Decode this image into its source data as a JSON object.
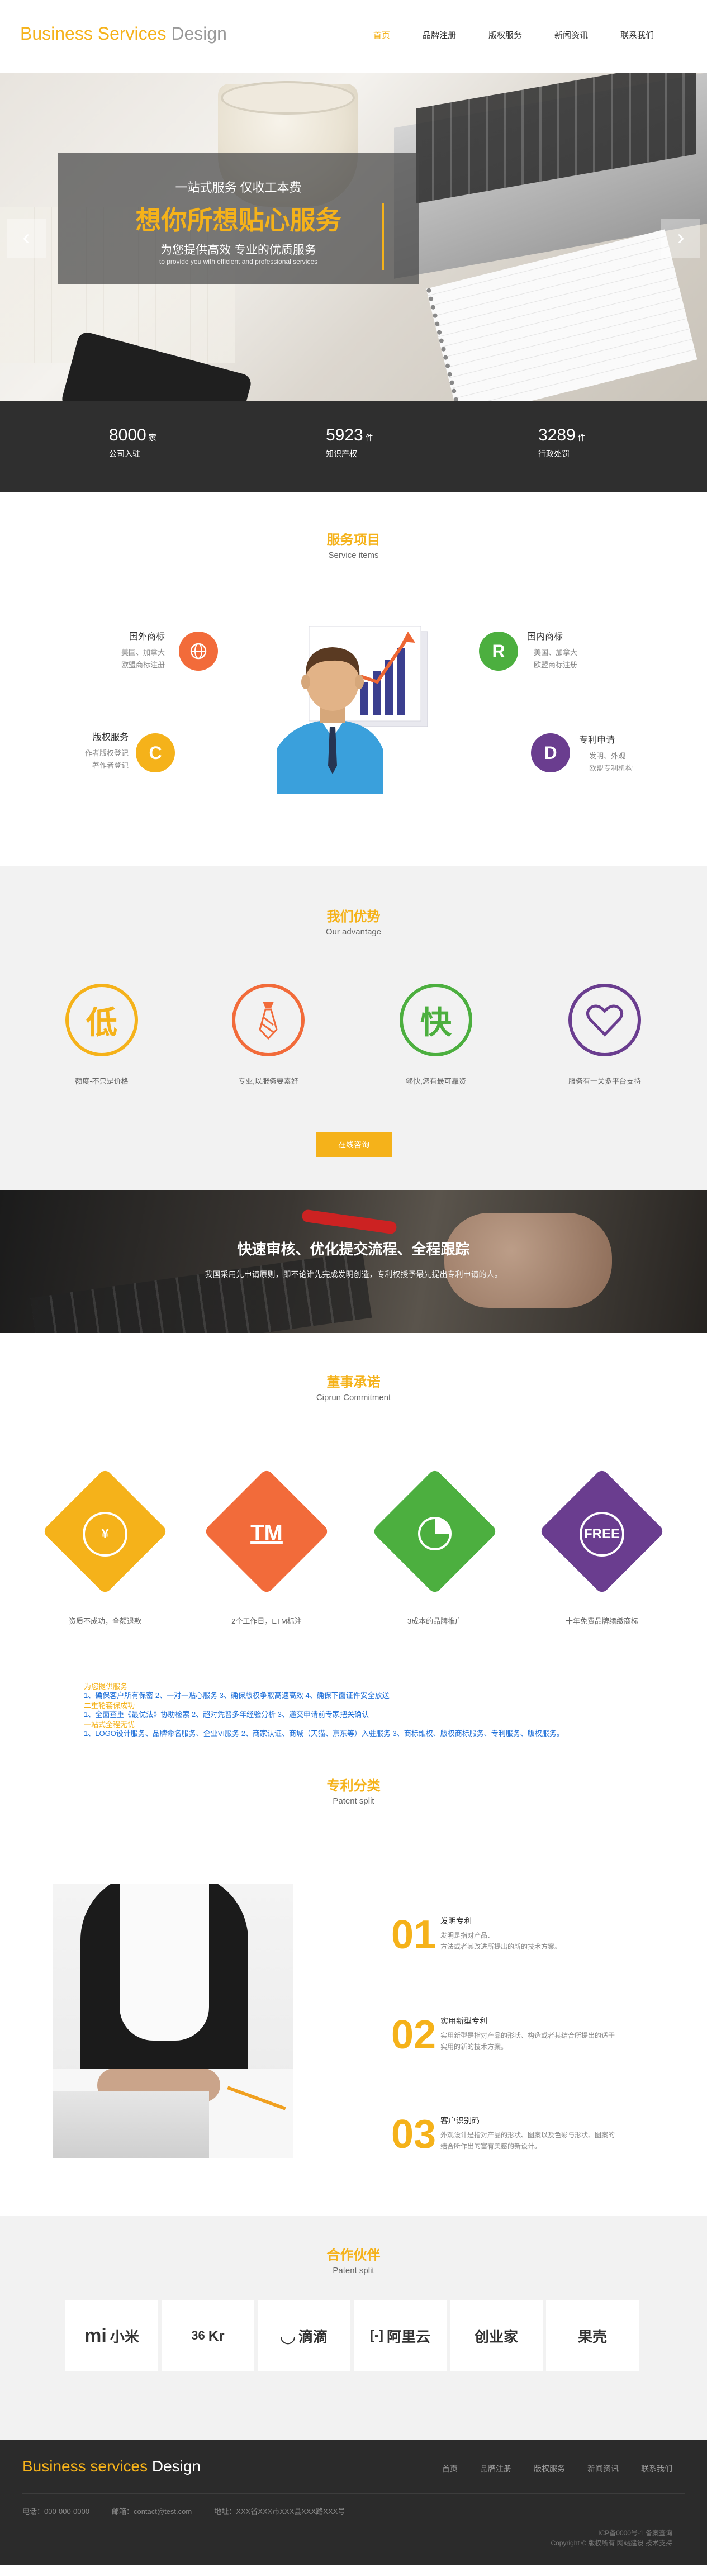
{
  "header": {
    "logo_part1": "Business Services",
    "logo_part2": "Design",
    "nav": [
      "首页",
      "品牌注册",
      "版权服务",
      "新闻资讯",
      "联系我们"
    ]
  },
  "hero": {
    "line1": "一站式服务 仅收工本费",
    "headline": "想你所想贴心服务",
    "line3": "为您提供高效 专业的优质服务",
    "line4": "to provide you with efficient and professional services",
    "prev": "‹",
    "next": "›"
  },
  "stats": [
    {
      "num": "8000",
      "unit": "家",
      "label": "公司入驻"
    },
    {
      "num": "5923",
      "unit": "件",
      "label": "知识产权"
    },
    {
      "num": "3289",
      "unit": "件",
      "label": "行政处罚"
    }
  ],
  "services": {
    "title_cn": "服务项目",
    "title_en": "Service items",
    "items": [
      {
        "title": "国外商标",
        "desc": [
          "美国、加拿大",
          "欧盟商标注册"
        ],
        "icon": "globe-icon",
        "color": "#f26b3a"
      },
      {
        "title": "国内商标",
        "desc": [
          "美国、加拿大",
          "欧盟商标注册"
        ],
        "icon": "r-icon",
        "color": "#4caf3f"
      },
      {
        "title": "版权服务",
        "desc": [
          "作者版权登记",
          "著作者登记"
        ],
        "icon": "c-icon",
        "color": "#f5b21a"
      },
      {
        "title": "专利申请",
        "desc": [
          "发明、外观",
          "欧盟专利机构"
        ],
        "icon": "d-icon",
        "color": "#6a3d8f"
      }
    ]
  },
  "advantage": {
    "title_cn": "我们优势",
    "title_en": "Our advantage",
    "items": [
      {
        "glyph": "低",
        "label": "额度-不只是价格",
        "color": "#f5b21a",
        "icon": "low-price-icon"
      },
      {
        "glyph": "👔",
        "label": "专业,以服务要素好",
        "color": "#f26b3a",
        "icon": "tie-icon"
      },
      {
        "glyph": "快",
        "label": "够快,您有最可靠资",
        "color": "#4caf3f",
        "icon": "fast-icon"
      },
      {
        "glyph": "♡",
        "label": "服务有一关多平台支持",
        "color": "#6a3d8f",
        "icon": "heart-icon"
      }
    ],
    "button": "在线咨询"
  },
  "banner2": {
    "title": "快速审核、优化提交流程、全程跟踪",
    "subtitle": "我国采用先申请原则，即不论谁先完成发明创造，专利权授予最先提出专利申请的人。"
  },
  "commitment": {
    "title_cn": "董事承诺",
    "title_en": "Ciprun Commitment",
    "items": [
      {
        "label": "资质不成功，全额退款",
        "color": "#f5b21a",
        "icon": "yen-icon",
        "glyph": "¥"
      },
      {
        "label": "2个工作日，ETM标注",
        "color": "#f26b3a",
        "icon": "tm-icon",
        "glyph": "TM"
      },
      {
        "label": "3成本的品牌推广",
        "color": "#4caf3f",
        "icon": "pie-chart-icon",
        "glyph": "◔"
      },
      {
        "label": "十年免费品牌续缴商标",
        "color": "#6a3d8f",
        "icon": "free-icon",
        "glyph": "FREE"
      }
    ],
    "notes": [
      {
        "head": "为您提供服务",
        "body": "1、确保客户所有保密  2、一对一贴心服务  3、确保版权争取高速高效  4、确保下面证件安全放送"
      },
      {
        "head": "二重轮套保成功",
        "body": "1、全面查重《最优法》协助检索  2、超对凭普多年经验分析  3、递交申请前专家把关确认"
      },
      {
        "head": "一站式全程无忧",
        "body": "1、LOGO设计服务、品牌命名服务、企业VI服务  2、商家认证、商城（天猫、京东等）入驻服务  3、商标维权、版权商标服务、专利服务、版权服务。"
      }
    ]
  },
  "patent": {
    "title_cn": "专利分类",
    "title_en": "Patent split",
    "items": [
      {
        "num": "01",
        "title": "发明专利",
        "desc": [
          "发明是指对产品、",
          "方法或者其改进所提出的新的技术方案。"
        ]
      },
      {
        "num": "02",
        "title": "实用新型专利",
        "desc": [
          "实用新型是指对产品的形状、构造或者其结合所提出的适于",
          "实用的新的技术方案。"
        ]
      },
      {
        "num": "03",
        "title": "客户识别码",
        "desc": [
          "外观设计是指对产品的形状、图案以及色彩与形状、图案的",
          "结合所作出的富有美感的新设计。"
        ]
      }
    ]
  },
  "partners": {
    "title_cn": "合作伙伴",
    "title_en": "Patent split",
    "items": [
      {
        "name": "小米",
        "mark": "mi",
        "icon": "xiaomi-logo"
      },
      {
        "name": "Kr",
        "mark": "36",
        "icon": "36kr-logo"
      },
      {
        "name": "滴滴",
        "mark": "◡",
        "icon": "didi-logo"
      },
      {
        "name": "阿里云",
        "mark": "[-]",
        "icon": "aliyun-logo"
      },
      {
        "name": "创业家",
        "mark": "",
        "icon": "chuangyejia-logo"
      },
      {
        "name": "果壳",
        "mark": "",
        "icon": "guokr-logo"
      }
    ]
  },
  "footer": {
    "logo_part1": "Business services",
    "logo_part2": "Design",
    "nav": [
      "首页",
      "品牌注册",
      "版权服务",
      "新闻资讯",
      "联系我们"
    ],
    "phone": "电话：000-000-0000",
    "email": "邮箱：contact@test.com",
    "address": "地址：XXX省XXX市XXX县XXX路XXX号",
    "copy1": "ICP备0000号-1 备案查询",
    "copy2": "Copyright © 版权所有 网站建设 技术支持"
  }
}
